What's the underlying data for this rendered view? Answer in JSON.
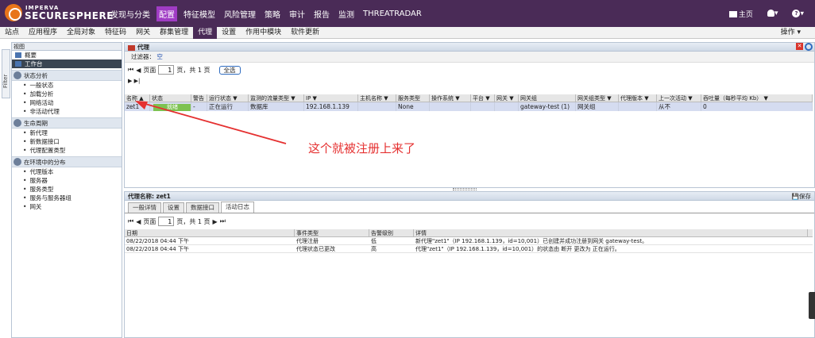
{
  "brand": {
    "small": "IMPERVA",
    "name": "SECURESPHERE"
  },
  "main_nav": [
    {
      "label": "发现与分类",
      "active": false
    },
    {
      "label": "配置",
      "active": true
    },
    {
      "label": "特征模型",
      "active": false
    },
    {
      "label": "风险管理",
      "active": false
    },
    {
      "label": "策略",
      "active": false
    },
    {
      "label": "审计",
      "active": false
    },
    {
      "label": "报告",
      "active": false
    },
    {
      "label": "监测",
      "active": false
    },
    {
      "label": "THREATRADAR",
      "active": false
    }
  ],
  "top_right": {
    "home": "主页",
    "user": "▾",
    "help": "▾"
  },
  "sub_nav": [
    {
      "label": "站点",
      "active": false
    },
    {
      "label": "应用程序",
      "active": false
    },
    {
      "label": "全局对象",
      "active": false
    },
    {
      "label": "特征码",
      "active": false
    },
    {
      "label": "网关",
      "active": false
    },
    {
      "label": "群集管理",
      "active": false
    },
    {
      "label": "代理",
      "active": true
    },
    {
      "label": "设置",
      "active": false
    },
    {
      "label": "作用中模块",
      "active": false
    },
    {
      "label": "软件更新",
      "active": false
    }
  ],
  "operations": "操作 ▾",
  "sidebar": {
    "header": "视图",
    "filter_tab": "Filter",
    "items": [
      {
        "label": "概要",
        "selected": false
      },
      {
        "label": "工作台",
        "selected": true
      }
    ],
    "groups": [
      {
        "title": "状态分析",
        "items": [
          "一般状态",
          "加载分析",
          "网络活动",
          "非活动代理"
        ]
      },
      {
        "title": "生命周期",
        "items": [
          "新代理",
          "新数据接口",
          "代理配置类型"
        ]
      },
      {
        "title": "在环境中的分布",
        "items": [
          "代理版本",
          "服务器",
          "服务类型",
          "服务与服务器组",
          "网关"
        ]
      }
    ]
  },
  "agents_panel": {
    "title": "代理",
    "filter_label": "过滤器：",
    "filter_value": "空",
    "pager": {
      "first": "⏮",
      "prev": "◀",
      "page_label": "页面",
      "page": "1",
      "total": "页，共 1 页",
      "select_all": "全选"
    },
    "nav2": "▶ ▶|",
    "columns": [
      "名称 ▲",
      "状态",
      "警告",
      "运行状态 ▼",
      "监测的流量类型 ▼",
      "IP ▼",
      "主机名称 ▼",
      "服务类型",
      "操作系统 ▼",
      "平台 ▼",
      "网关 ▼",
      "网关组",
      "网关组类型 ▼",
      "代理版本 ▼",
      "上一次活动 ▼",
      "吞吐量（每秒平均 Kb） ▼"
    ],
    "rows": [
      [
        "zet1",
        "",
        "-",
        "正在运行",
        "数据库",
        "192.168.1.139",
        "",
        "None",
        "",
        "",
        "",
        "gateway-test (1)",
        "网关组",
        "",
        "从不",
        "0"
      ]
    ],
    "status_badge": "就绪"
  },
  "annotation": "这个就被注册上来了",
  "detail_panel": {
    "title": "代理名称: zet1",
    "save": "保存",
    "tabs": [
      {
        "label": "一般详情",
        "active": false
      },
      {
        "label": "设置",
        "active": false
      },
      {
        "label": "数据接口",
        "active": false
      },
      {
        "label": "活动日志",
        "active": true
      }
    ],
    "pager": {
      "page_label": "页面",
      "page": "1",
      "total": "页，共 1 页"
    },
    "columns": [
      "日期",
      "事件类型",
      "告警级别",
      "详情"
    ],
    "rows": [
      [
        "08/22/2018 04:44 下午",
        "代理注册",
        "低",
        "新代理\"zet1\"（IP 192.168.1.139，id=10,001）已创建并成功注册到网关 gateway-test。"
      ],
      [
        "08/22/2018 04:44 下午",
        "代理状态已更改",
        "高",
        "代理\"zet1\"（IP 192.168.1.139，id=10,001）的状态由 断开 更改为 正在运行。"
      ]
    ]
  },
  "colors": {
    "topbar": "#4a2b57",
    "active_nav": "#a03cc4",
    "row_highlight": "#d5dcf0",
    "status_ok": "#7dc251",
    "annotation": "#e53030"
  }
}
